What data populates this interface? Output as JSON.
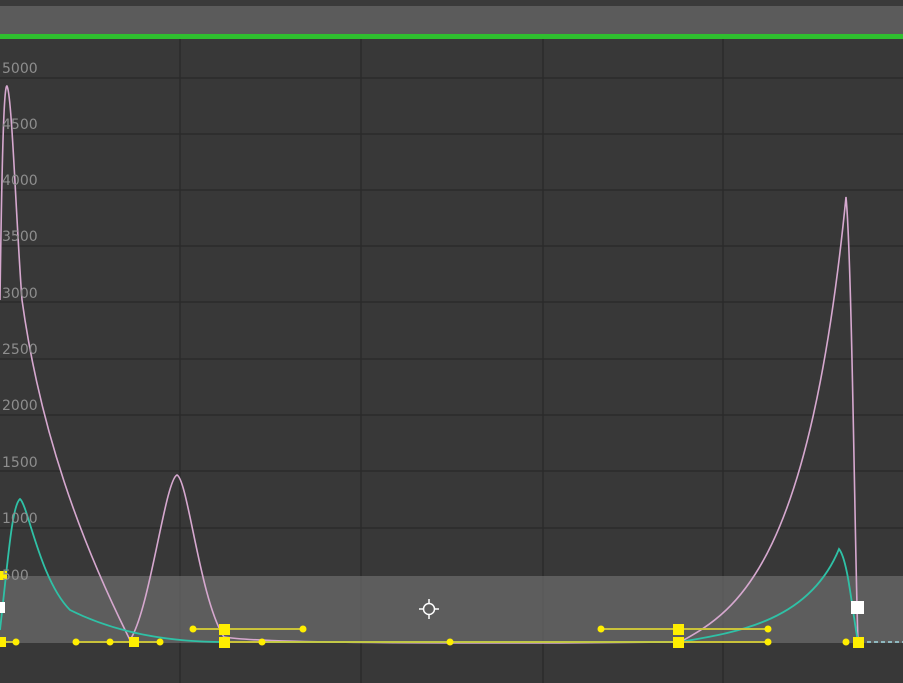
{
  "editor": {
    "y_axis_labels": [
      "5000",
      "4500",
      "4000",
      "3500",
      "3000",
      "2500",
      "2000",
      "1500",
      "1000",
      "500"
    ]
  },
  "colors": {
    "background": "#383838",
    "grid": "#2a2a2a",
    "range_bar": "#2fbf2f",
    "selection": "#5e5e5e",
    "curve_pink": "#d6a8cf",
    "curve_teal": "#2fc1a6",
    "keyframe": "#ffee00"
  },
  "icons": {
    "cursor": "crosshair-cursor-icon"
  }
}
